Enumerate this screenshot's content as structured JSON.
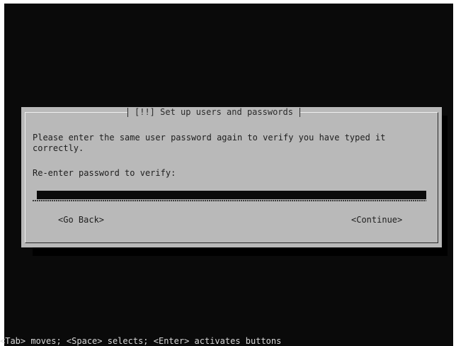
{
  "dialog": {
    "title": "[!!] Set up users and passwords",
    "message": "Please enter the same user password again to verify you have typed it\ncorrectly.",
    "prompt": "Re-enter password to verify:",
    "password_value": "",
    "buttons": {
      "back": "<Go Back>",
      "continue": "<Continue>"
    }
  },
  "help_line": "<Tab> moves; <Space> selects; <Enter> activates buttons",
  "colors": {
    "screen_background": "#0a0a0a",
    "dialog_background": "#b9b9b9",
    "input_background": "#0b0b0b",
    "text": "#1e1e1e",
    "help_text": "#d8d8d8"
  }
}
